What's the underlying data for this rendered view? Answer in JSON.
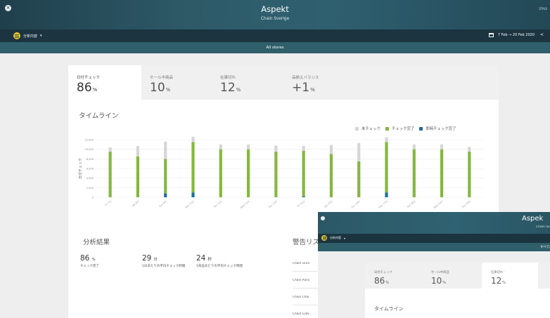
{
  "header": {
    "title": "Aspekt",
    "subtitle": "Chain Sverige",
    "stage": "STAGI"
  },
  "toolbar": {
    "menu_label": "分析内容",
    "date_range": "7 Feb → 20 Feb 2020",
    "prev": "<"
  },
  "banner": {
    "text": "All stores"
  },
  "kpis": [
    {
      "label": "日付チェック",
      "value": "86",
      "unit": "%",
      "active": true
    },
    {
      "label": "セール中商品",
      "value": "10",
      "unit": "%",
      "active": false
    },
    {
      "label": "在庫切れ",
      "value": "12",
      "unit": "%",
      "active": false
    },
    {
      "label": "品揃えバランス",
      "value": "+1",
      "unit": "%",
      "active": false
    }
  ],
  "timeline": {
    "title": "タイムライン",
    "legend": [
      {
        "label": "未チェック",
        "color": "#d6d6d6"
      },
      {
        "label": "チェック完了",
        "color": "#84b83d"
      },
      {
        "label": "即時チェック完了",
        "color": "#1f6f99"
      }
    ]
  },
  "chart_data": {
    "type": "bar",
    "ylabel": "日付チェック",
    "y_ticks": [
      "12,000",
      "10,000",
      "8,000",
      "6,000",
      "4,000",
      "2,000",
      "0"
    ],
    "ylim": [
      0,
      12000
    ],
    "categories": [
      "Fri 7/2",
      "Sat 8/2",
      "Sun 9/2",
      "Mon 10/2",
      "Tue 11/2",
      "Wed 12/2",
      "Thu 13/2",
      "Fri 14/2",
      "Sat 15/2",
      "Sun 16/2",
      "Mon 17/2",
      "Tue 18/2",
      "Wed 19/2",
      "Thu 20/2"
    ],
    "series": [
      {
        "name": "チェック完了",
        "color": "#84b83d",
        "values": [
          9500,
          8500,
          7200,
          10500,
          10000,
          10000,
          9500,
          9500,
          9000,
          7500,
          10500,
          10000,
          10000,
          9500
        ]
      },
      {
        "name": "即時チェック完了",
        "color": "#1f6f99",
        "values": [
          0,
          0,
          800,
          1000,
          0,
          0,
          0,
          200,
          0,
          0,
          1000,
          0,
          0,
          0
        ]
      },
      {
        "name": "未チェック",
        "color": "#d6d6d6",
        "values": [
          900,
          2200,
          3600,
          1100,
          1000,
          1000,
          1300,
          1000,
          1900,
          3800,
          1000,
          1000,
          1000,
          1000
        ]
      }
    ],
    "grid": true,
    "legend_position": "top-right"
  },
  "results": {
    "title": "分析結果",
    "stats": [
      {
        "value": "86",
        "unit": "%",
        "caption": "チェック完了"
      },
      {
        "value": "29",
        "unit": "分",
        "caption": "1日あたりの平均チェック時間"
      },
      {
        "value": "24",
        "unit": "秒",
        "caption": "1商品あたりの平均チェック時間"
      }
    ]
  },
  "alerts": {
    "title": "警告リスト",
    "items": [
      "Chain Grun",
      "Chain Alinc",
      "Chain Chai",
      "Chain Ludv"
    ]
  },
  "overlay": {
    "title": "Aspekt",
    "subtitle": "Chain Sverige",
    "menu_label": "分析内容",
    "banner": "すべての店舗",
    "kpis": [
      {
        "label": "日付チェック",
        "value": "86",
        "unit": "%",
        "active": false
      },
      {
        "label": "セール中商品",
        "value": "10",
        "unit": "%",
        "active": false
      },
      {
        "label": "在庫切れ ⁱ",
        "value": "12",
        "unit": "%",
        "active": true
      }
    ],
    "timeline_title": "タイムライン"
  }
}
